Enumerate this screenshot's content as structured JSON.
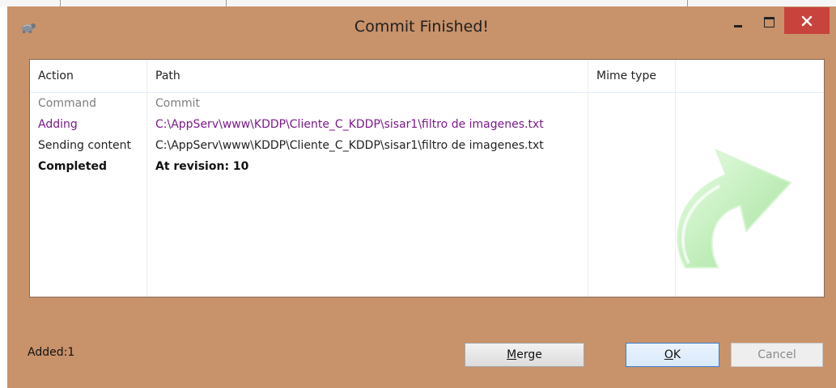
{
  "window": {
    "title": "Commit Finished!",
    "colors": {
      "frame": "#c8926a",
      "close": "#c8433c",
      "adding": "#7a1a8a"
    }
  },
  "list": {
    "columns": [
      "Action",
      "Path",
      "Mime type"
    ],
    "rows": [
      {
        "action": "Command",
        "path": "Commit",
        "style": "gray"
      },
      {
        "action": "Adding",
        "path": "C:\\AppServ\\www\\KDDP\\Cliente_C_KDDP\\sisar1\\filtro de imagenes.txt",
        "style": "purple"
      },
      {
        "action": "Sending content",
        "path": "C:\\AppServ\\www\\KDDP\\Cliente_C_KDDP\\sisar1\\filtro de imagenes.txt",
        "style": "normal"
      },
      {
        "action": "Completed",
        "path": "At revision: 10",
        "style": "bold"
      }
    ]
  },
  "status": {
    "text": "Added:1"
  },
  "buttons": {
    "merge": {
      "mnemonic": "M",
      "rest": "erge"
    },
    "ok": {
      "mnemonic": "O",
      "rest": "K"
    },
    "cancel": "Cancel"
  },
  "icons": [
    "tortoise-icon",
    "minimize-icon",
    "maximize-icon",
    "close-icon",
    "green-arrow-icon"
  ]
}
